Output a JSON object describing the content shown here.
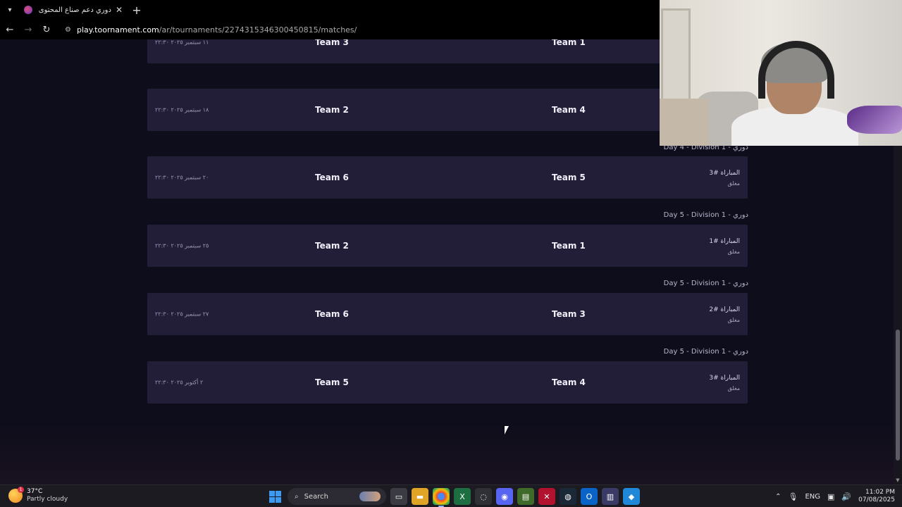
{
  "browser": {
    "tab_title": "دوري دعم صناع المحتوى - Matches",
    "url_host": "play.toornament.com",
    "url_path": "/ar/tournaments/2274315346300450815/matches/",
    "new_tab": "+",
    "close_tab": "✕"
  },
  "page": {
    "matches": [
      {
        "label": "",
        "date": "١١ سبتمبر ٢٠٢٥ ٢٢:٣٠",
        "team_a": "Team 3",
        "team_b": "Team 1",
        "number": "",
        "status": ""
      },
      {
        "label": "",
        "date": "١٨ سبتمبر ٢٠٢٥ ٢٢:٣٠",
        "team_a": "Team 2",
        "team_b": "Team 4",
        "number": "",
        "status": ""
      },
      {
        "label": "Day 4 - Division 1 - دوري",
        "date": "٢٠ سبتمبر ٢٠٢٥ ٢٢:٣٠",
        "team_a": "Team 6",
        "team_b": "Team 5",
        "number": "المباراة #3",
        "status": "مغلق"
      },
      {
        "label": "Day 5 - Division 1 - دوري",
        "date": "٢٥ سبتمبر ٢٠٢٥ ٢٢:٣٠",
        "team_a": "Team 2",
        "team_b": "Team 1",
        "number": "المباراة #1",
        "status": "مغلق"
      },
      {
        "label": "Day 5 - Division 1 - دوري",
        "date": "٢٧ سبتمبر ٢٠٢٥ ٢٢:٣٠",
        "team_a": "Team 6",
        "team_b": "Team 3",
        "number": "المباراة #2",
        "status": "مغلق"
      },
      {
        "label": "Day 5 - Division 1 - دوري",
        "date": "٢ أكتوبر ٢٠٢٥ ٢٢:٣٠",
        "team_a": "Team 5",
        "team_b": "Team 4",
        "number": "المباراة #3",
        "status": "مغلق"
      }
    ]
  },
  "taskbar": {
    "weather_temp": "37°C",
    "weather_condition": "Partly cloudy",
    "weather_badge": "1",
    "search_label": "Search",
    "language": "ENG",
    "time": "11:02 PM",
    "date": "07/08/2025"
  },
  "colors": {
    "card_bg": "#221e38",
    "page_bg": "#0e0d1b",
    "accent": "#3a9bf0"
  }
}
